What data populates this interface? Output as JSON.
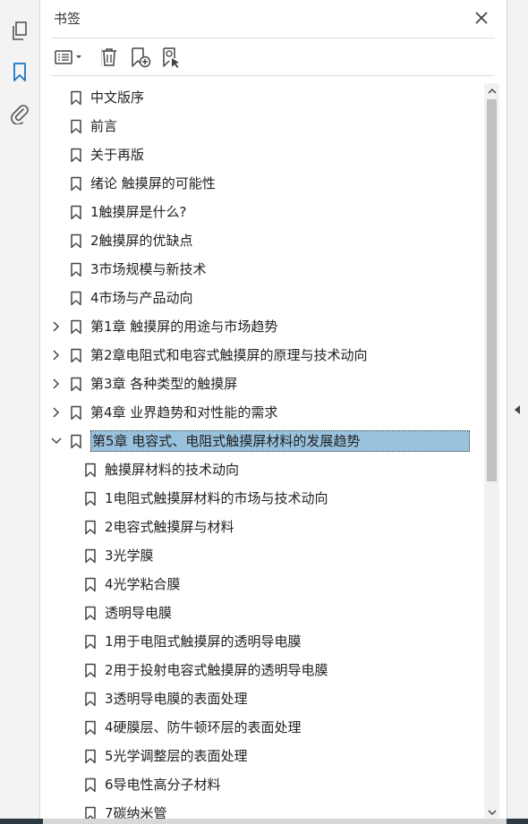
{
  "panel": {
    "title": "书签",
    "close_icon": "close-icon"
  },
  "rail": {
    "items": [
      {
        "icon": "page-thumbnails-icon"
      },
      {
        "icon": "bookmark-icon",
        "active": true
      },
      {
        "icon": "attachment-icon"
      }
    ]
  },
  "toolbar": {
    "options_icon": "options-menu-icon",
    "delete_icon": "delete-bookmark-icon",
    "new_icon": "new-bookmark-icon",
    "find_icon": "find-current-bookmark-icon"
  },
  "colors": {
    "selected_bg": "#99c2de",
    "accent": "#1a73c8"
  },
  "bookmarks": [
    {
      "label": "中文版序",
      "level": 0,
      "expandable": false
    },
    {
      "label": "前言",
      "level": 0,
      "expandable": false
    },
    {
      "label": "关于再版",
      "level": 0,
      "expandable": false
    },
    {
      "label": "绪论  触摸屏的可能性",
      "level": 0,
      "expandable": false
    },
    {
      "label": "1触摸屏是什么?",
      "level": 0,
      "expandable": false
    },
    {
      "label": "2触摸屏的优缺点",
      "level": 0,
      "expandable": false
    },
    {
      "label": "3市场规模与新技术",
      "level": 0,
      "expandable": false
    },
    {
      "label": "4市场与产品动向",
      "level": 0,
      "expandable": false
    },
    {
      "label": "第1章  触摸屏的用途与市场趋势",
      "level": 0,
      "expandable": true,
      "expanded": false
    },
    {
      "label": "第2章电阻式和电容式触摸屏的原理与技术动向",
      "level": 0,
      "expandable": true,
      "expanded": false
    },
    {
      "label": "第3章  各种类型的触摸屏",
      "level": 0,
      "expandable": true,
      "expanded": false
    },
    {
      "label": "第4章  业界趋势和对性能的需求",
      "level": 0,
      "expandable": true,
      "expanded": false
    },
    {
      "label": "第5章  电容式、电阻式触摸屏材料的发展趋势",
      "level": 0,
      "expandable": true,
      "expanded": true,
      "selected": true
    },
    {
      "label": "触摸屏材料的技术动向",
      "level": 1,
      "expandable": false
    },
    {
      "label": "1电阻式触摸屏材料的市场与技术动向",
      "level": 1,
      "expandable": false
    },
    {
      "label": "2电容式触摸屏与材料",
      "level": 1,
      "expandable": false
    },
    {
      "label": "3光学膜",
      "level": 1,
      "expandable": false
    },
    {
      "label": "4光学粘合膜",
      "level": 1,
      "expandable": false
    },
    {
      "label": "透明导电膜",
      "level": 1,
      "expandable": false
    },
    {
      "label": "1用于电阻式触摸屏的透明导电膜",
      "level": 1,
      "expandable": false
    },
    {
      "label": "2用于投射电容式触摸屏的透明导电膜",
      "level": 1,
      "expandable": false
    },
    {
      "label": "3透明导电膜的表面处理",
      "level": 1,
      "expandable": false
    },
    {
      "label": "4硬膜层、防牛顿环层的表面处理",
      "level": 1,
      "expandable": false
    },
    {
      "label": "5光学调整层的表面处理",
      "level": 1,
      "expandable": false
    },
    {
      "label": "6导电性高分子材料",
      "level": 1,
      "expandable": false
    },
    {
      "label": "7碳纳米管",
      "level": 1,
      "expandable": false
    }
  ]
}
